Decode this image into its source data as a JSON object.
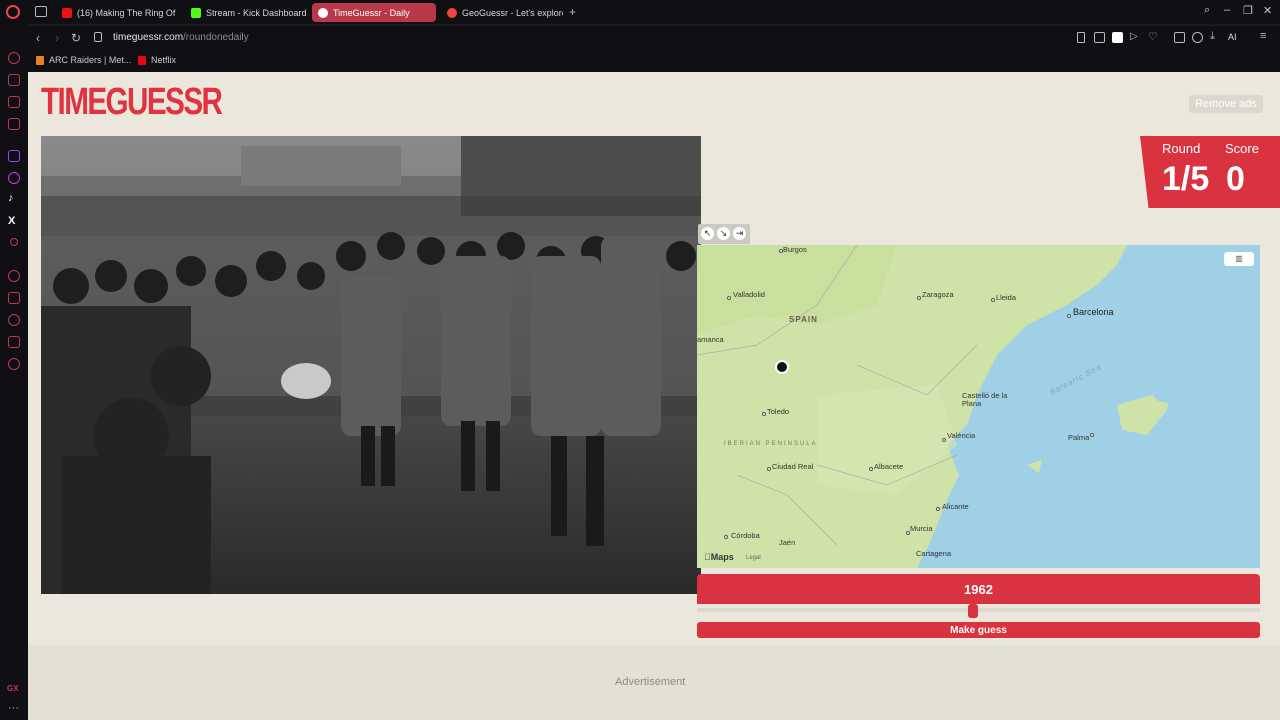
{
  "browser": {
    "tabs": [
      {
        "label": "(16) Making The Ring Of S",
        "fav_color": "#e11",
        "active": false
      },
      {
        "label": "Stream - Kick Dashboard",
        "fav_color": "#53fc18",
        "active": false
      },
      {
        "label": "TimeGuessr - Daily",
        "fav_color": "#fff",
        "active": true
      },
      {
        "label": "GeoGuessr - Let's explore",
        "fav_color": "#e44",
        "active": false
      }
    ],
    "new_tab": "+",
    "address": {
      "domain": "timeguessr.com",
      "path": "/roundonedaily"
    },
    "ai_label": "AI",
    "bookmarks": [
      {
        "label": "ARC Raiders | Met...",
        "fav_color": "#e8832a"
      },
      {
        "label": "Netflix",
        "fav_color": "#e50914"
      }
    ],
    "sidebar_gx": "GX",
    "sidebar_more": "···"
  },
  "game": {
    "logo": "TIMEGUESSR",
    "remove_ads": "Remove ads",
    "round_label": "Round",
    "round_value": "1/5",
    "score_label": "Score",
    "score_value": "0",
    "year": "1962",
    "year_slider_fraction": 0.49,
    "make_guess": "Make guess",
    "advertisement": "Advertisement"
  },
  "map": {
    "labels": {
      "burgos": "Burgos",
      "valladolid": "Valladolid",
      "spain": "SPAIN",
      "zaragoza": "Zaragoza",
      "lleida": "Lleida",
      "barcelona": "Barcelona",
      "salamanca": "amanca",
      "toledo": "Toledo",
      "castello": "Castelló de la Plana",
      "balearic": "Balearic Sea",
      "valencia": "València",
      "palma": "Palma",
      "peninsula": "IBERIAN PENINSULA",
      "ciudad_real": "Ciudad Real",
      "albacete": "Albacete",
      "alicante": "Alicante",
      "cordoba": "Córdoba",
      "murcia": "Murcia",
      "jaen": "Jaén",
      "cartagena": "Cartagena"
    },
    "apple_maps": "Maps",
    "legal": "Legal"
  },
  "colors": {
    "brand_red": "#d9333f",
    "page_bg": "#ebe7dc",
    "land": "#cfe3a8",
    "sea": "#9fd0e6"
  }
}
